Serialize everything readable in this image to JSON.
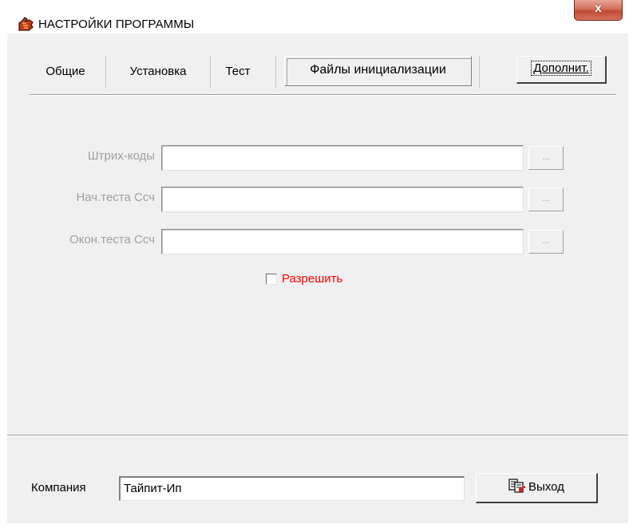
{
  "window": {
    "title": "НАСТРОЙКИ ПРОГРАММЫ",
    "close_label": "x"
  },
  "tabs": [
    {
      "label": "Общие"
    },
    {
      "label": "Установка"
    },
    {
      "label": "Тест"
    },
    {
      "label": "Файлы инициализации",
      "active": true
    }
  ],
  "extra_button": "Дополнит.",
  "fields": [
    {
      "label": "Штрих-коды",
      "value": "",
      "browse": "..."
    },
    {
      "label": "Нач.теста Ссч",
      "value": "",
      "browse": "..."
    },
    {
      "label": "Окон.теста Ссч",
      "value": "",
      "browse": "..."
    }
  ],
  "allow_checkbox": {
    "label": "Разрешить",
    "checked": false
  },
  "footer": {
    "company_label": "Компания",
    "company_value": "Тайпит-Ип",
    "exit_label": "Выход"
  },
  "icons": {
    "title": "settings-hand-icon",
    "exit": "exit-doc-icon"
  },
  "colors": {
    "accent_red": "#ff0000",
    "disabled_text": "#a0a0a0",
    "close_button": "#c94e38"
  }
}
